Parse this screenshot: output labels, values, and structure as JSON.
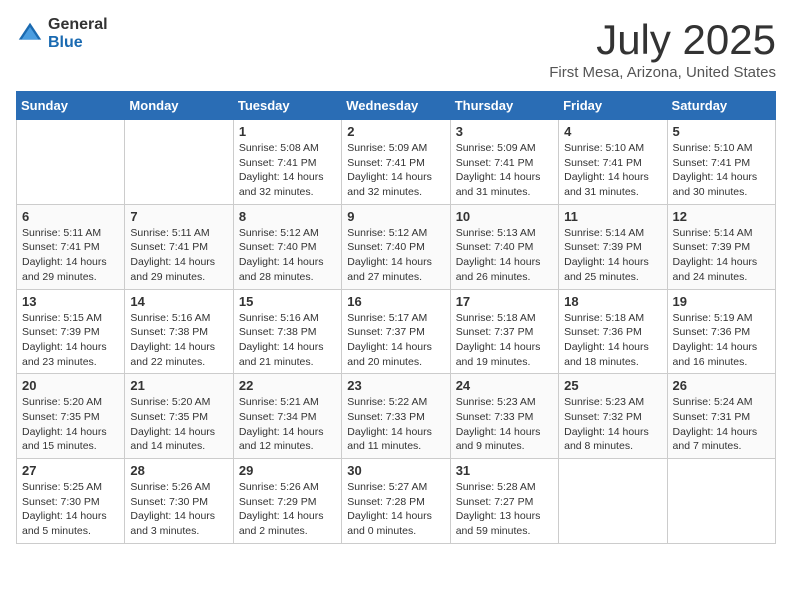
{
  "logo": {
    "general": "General",
    "blue": "Blue"
  },
  "title": {
    "month": "July 2025",
    "location": "First Mesa, Arizona, United States"
  },
  "weekdays": [
    "Sunday",
    "Monday",
    "Tuesday",
    "Wednesday",
    "Thursday",
    "Friday",
    "Saturday"
  ],
  "weeks": [
    [
      {
        "day": "",
        "info": ""
      },
      {
        "day": "",
        "info": ""
      },
      {
        "day": "1",
        "info": "Sunrise: 5:08 AM\nSunset: 7:41 PM\nDaylight: 14 hours and 32 minutes."
      },
      {
        "day": "2",
        "info": "Sunrise: 5:09 AM\nSunset: 7:41 PM\nDaylight: 14 hours and 32 minutes."
      },
      {
        "day": "3",
        "info": "Sunrise: 5:09 AM\nSunset: 7:41 PM\nDaylight: 14 hours and 31 minutes."
      },
      {
        "day": "4",
        "info": "Sunrise: 5:10 AM\nSunset: 7:41 PM\nDaylight: 14 hours and 31 minutes."
      },
      {
        "day": "5",
        "info": "Sunrise: 5:10 AM\nSunset: 7:41 PM\nDaylight: 14 hours and 30 minutes."
      }
    ],
    [
      {
        "day": "6",
        "info": "Sunrise: 5:11 AM\nSunset: 7:41 PM\nDaylight: 14 hours and 29 minutes."
      },
      {
        "day": "7",
        "info": "Sunrise: 5:11 AM\nSunset: 7:41 PM\nDaylight: 14 hours and 29 minutes."
      },
      {
        "day": "8",
        "info": "Sunrise: 5:12 AM\nSunset: 7:40 PM\nDaylight: 14 hours and 28 minutes."
      },
      {
        "day": "9",
        "info": "Sunrise: 5:12 AM\nSunset: 7:40 PM\nDaylight: 14 hours and 27 minutes."
      },
      {
        "day": "10",
        "info": "Sunrise: 5:13 AM\nSunset: 7:40 PM\nDaylight: 14 hours and 26 minutes."
      },
      {
        "day": "11",
        "info": "Sunrise: 5:14 AM\nSunset: 7:39 PM\nDaylight: 14 hours and 25 minutes."
      },
      {
        "day": "12",
        "info": "Sunrise: 5:14 AM\nSunset: 7:39 PM\nDaylight: 14 hours and 24 minutes."
      }
    ],
    [
      {
        "day": "13",
        "info": "Sunrise: 5:15 AM\nSunset: 7:39 PM\nDaylight: 14 hours and 23 minutes."
      },
      {
        "day": "14",
        "info": "Sunrise: 5:16 AM\nSunset: 7:38 PM\nDaylight: 14 hours and 22 minutes."
      },
      {
        "day": "15",
        "info": "Sunrise: 5:16 AM\nSunset: 7:38 PM\nDaylight: 14 hours and 21 minutes."
      },
      {
        "day": "16",
        "info": "Sunrise: 5:17 AM\nSunset: 7:37 PM\nDaylight: 14 hours and 20 minutes."
      },
      {
        "day": "17",
        "info": "Sunrise: 5:18 AM\nSunset: 7:37 PM\nDaylight: 14 hours and 19 minutes."
      },
      {
        "day": "18",
        "info": "Sunrise: 5:18 AM\nSunset: 7:36 PM\nDaylight: 14 hours and 18 minutes."
      },
      {
        "day": "19",
        "info": "Sunrise: 5:19 AM\nSunset: 7:36 PM\nDaylight: 14 hours and 16 minutes."
      }
    ],
    [
      {
        "day": "20",
        "info": "Sunrise: 5:20 AM\nSunset: 7:35 PM\nDaylight: 14 hours and 15 minutes."
      },
      {
        "day": "21",
        "info": "Sunrise: 5:20 AM\nSunset: 7:35 PM\nDaylight: 14 hours and 14 minutes."
      },
      {
        "day": "22",
        "info": "Sunrise: 5:21 AM\nSunset: 7:34 PM\nDaylight: 14 hours and 12 minutes."
      },
      {
        "day": "23",
        "info": "Sunrise: 5:22 AM\nSunset: 7:33 PM\nDaylight: 14 hours and 11 minutes."
      },
      {
        "day": "24",
        "info": "Sunrise: 5:23 AM\nSunset: 7:33 PM\nDaylight: 14 hours and 9 minutes."
      },
      {
        "day": "25",
        "info": "Sunrise: 5:23 AM\nSunset: 7:32 PM\nDaylight: 14 hours and 8 minutes."
      },
      {
        "day": "26",
        "info": "Sunrise: 5:24 AM\nSunset: 7:31 PM\nDaylight: 14 hours and 7 minutes."
      }
    ],
    [
      {
        "day": "27",
        "info": "Sunrise: 5:25 AM\nSunset: 7:30 PM\nDaylight: 14 hours and 5 minutes."
      },
      {
        "day": "28",
        "info": "Sunrise: 5:26 AM\nSunset: 7:30 PM\nDaylight: 14 hours and 3 minutes."
      },
      {
        "day": "29",
        "info": "Sunrise: 5:26 AM\nSunset: 7:29 PM\nDaylight: 14 hours and 2 minutes."
      },
      {
        "day": "30",
        "info": "Sunrise: 5:27 AM\nSunset: 7:28 PM\nDaylight: 14 hours and 0 minutes."
      },
      {
        "day": "31",
        "info": "Sunrise: 5:28 AM\nSunset: 7:27 PM\nDaylight: 13 hours and 59 minutes."
      },
      {
        "day": "",
        "info": ""
      },
      {
        "day": "",
        "info": ""
      }
    ]
  ]
}
